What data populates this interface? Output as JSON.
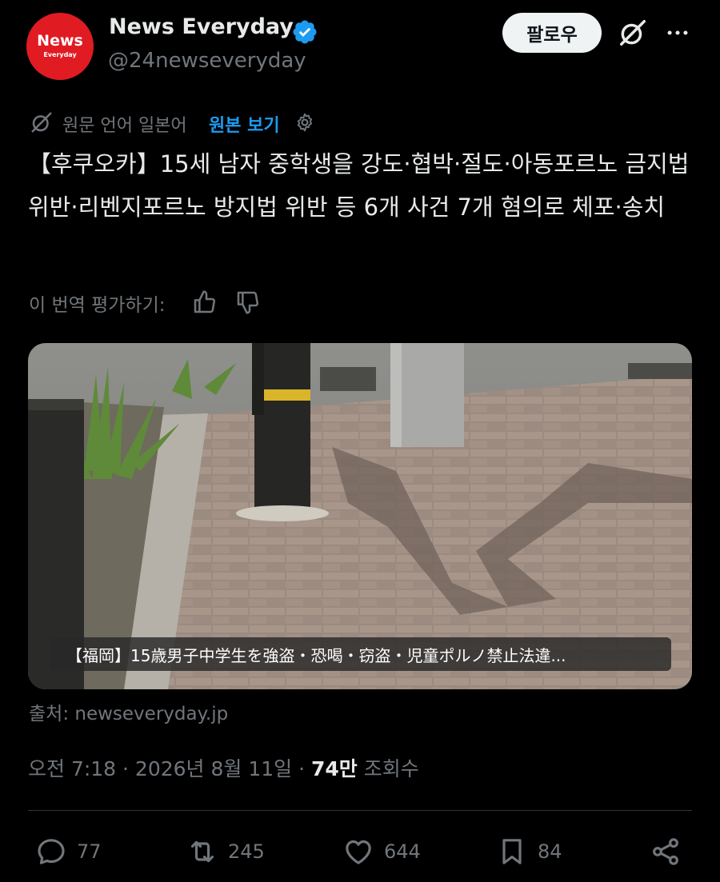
{
  "author": {
    "avatar_big": "News",
    "avatar_small": "Everyday",
    "display_name": "News Everyday",
    "handle": "@24newseveryday",
    "follow_label": "팔로우"
  },
  "translation": {
    "notice": "원문 언어 일본어",
    "show_original": "원본 보기"
  },
  "tweet": {
    "text": "【후쿠오카】15세 남자 중학생을 강도·협박·절도·아동포르노 금지법 위반·리벤지포르노 방지법 위반 등 6개 사건 7개 혐의로 체포·송치",
    "rate_label": "이 번역 평가하기:",
    "media_caption": "【福岡】15歳男子中学生を強盗・恐喝・窃盗・児童ポルノ禁止法違...",
    "source": "출처: newseveryday.jp",
    "timestamp": "오전 7:18 · 2026년 8월 11일 · ",
    "views_count": "74만",
    "views_label": " 조회수"
  },
  "actions": {
    "replies": "77",
    "reposts": "245",
    "likes": "644",
    "bookmarks": "84"
  },
  "colors": {
    "background": "#000000",
    "accent": "#1d9bf0",
    "verified": "#1d9bf0",
    "avatar": "#e11b22",
    "muted": "#71767b"
  }
}
